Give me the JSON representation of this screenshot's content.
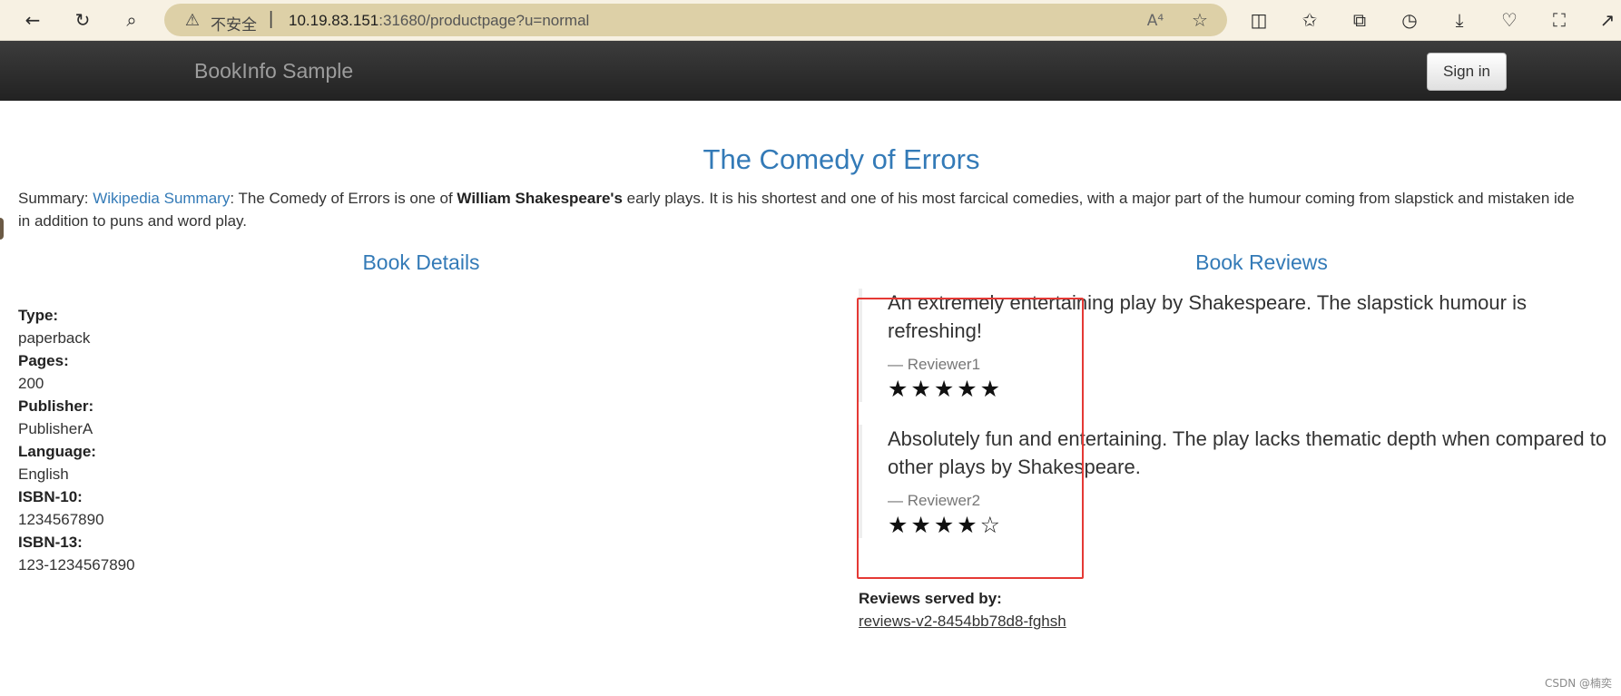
{
  "browser": {
    "insecure_label": "不安全",
    "separator": "|",
    "url_host": "10.19.83.151",
    "url_rest": ":31680/productpage?u=normal",
    "read_aloud_label": "A⁴",
    "icons": [
      "back-icon",
      "refresh-icon",
      "search-icon",
      "warning-icon",
      "read-aloud-icon",
      "favorite-star-icon",
      "split-screen-icon",
      "favorites-icon",
      "collections-icon",
      "history-icon",
      "downloads-icon",
      "health-icon",
      "screenshot-icon",
      "share-icon"
    ]
  },
  "navbar": {
    "brand": "BookInfo Sample",
    "signin_label": "Sign in"
  },
  "book": {
    "title": "The Comedy of Errors",
    "summary_prefix": "Summary: ",
    "summary_link": "Wikipedia Summary",
    "summary_text1": ": The Comedy of Errors is one of ",
    "summary_bold": "William Shakespeare's",
    "summary_text2": " early plays. It is his shortest and one of his most farcical comedies, with a major part of the humour coming from slapstick and mistaken ide",
    "summary_line2": "in addition to puns and word play."
  },
  "details": {
    "title": "Book Details",
    "items": [
      {
        "label": "Type:",
        "value": "paperback"
      },
      {
        "label": "Pages:",
        "value": "200"
      },
      {
        "label": "Publisher:",
        "value": "PublisherA"
      },
      {
        "label": "Language:",
        "value": "English"
      },
      {
        "label": "ISBN-10:",
        "value": "1234567890"
      },
      {
        "label": "ISBN-13:",
        "value": "123-1234567890"
      }
    ]
  },
  "reviews": {
    "title": "Book Reviews",
    "items": [
      {
        "text": "An extremely entertaining play by Shakespeare. The slapstick humour is refreshing!",
        "reviewer": "— Reviewer1",
        "stars": "★★★★★",
        "rating": 5
      },
      {
        "text": "Absolutely fun and entertaining. The play lacks thematic depth when compared to other plays by Shakespeare.",
        "reviewer": "— Reviewer2",
        "stars": "★★★★☆",
        "rating": 4
      }
    ],
    "served_by_label": "Reviews served by:",
    "served_by_value": "reviews-v2-8454bb78d8-fghsh"
  },
  "watermark": "CSDN @楠奕",
  "colors": {
    "link": "#337ab7",
    "navbar": "#222222",
    "highlight": "#e53935"
  }
}
